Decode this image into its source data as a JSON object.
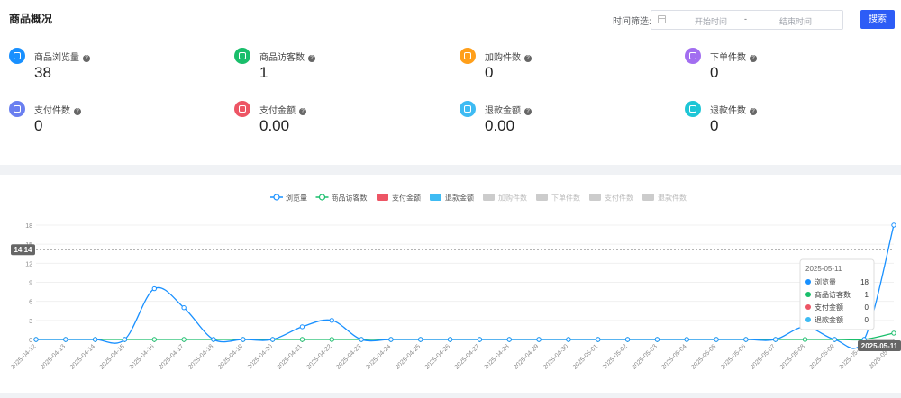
{
  "page": {
    "title": "商品概况"
  },
  "filter": {
    "label": "时间筛选:",
    "start_placeholder": "开始时间",
    "separator": "-",
    "end_placeholder": "结束时间",
    "search_label": "搜索"
  },
  "stats": [
    {
      "label": "商品浏览量",
      "value": "38",
      "color": "#1890ff"
    },
    {
      "label": "商品访客数",
      "value": "1",
      "color": "#19be6b"
    },
    {
      "label": "加购件数",
      "value": "0",
      "color": "#ff9f1a"
    },
    {
      "label": "下单件数",
      "value": "0",
      "color": "#a26ef0"
    },
    {
      "label": "支付件数",
      "value": "0",
      "color": "#6a7ff0"
    },
    {
      "label": "支付金额",
      "value": "0.00",
      "color": "#ed5565"
    },
    {
      "label": "退款金额",
      "value": "0.00",
      "color": "#3ebbf3"
    },
    {
      "label": "退款件数",
      "value": "0",
      "color": "#1ec6d6"
    }
  ],
  "chart_data": {
    "type": "line",
    "x": [
      "2025-04-12",
      "2025-04-13",
      "2025-04-14",
      "2025-04-15",
      "2025-04-16",
      "2025-04-17",
      "2025-04-18",
      "2025-04-19",
      "2025-04-20",
      "2025-04-21",
      "2025-04-22",
      "2025-04-23",
      "2025-04-24",
      "2025-04-25",
      "2025-04-26",
      "2025-04-27",
      "2025-04-28",
      "2025-04-29",
      "2025-04-30",
      "2025-05-01",
      "2025-05-02",
      "2025-05-03",
      "2025-05-04",
      "2025-05-05",
      "2025-05-06",
      "2025-05-07",
      "2025-05-08",
      "2025-05-09",
      "2025-05-10",
      "2025-05-11"
    ],
    "y_ticks": [
      "0",
      "3",
      "6",
      "9",
      "12",
      "15",
      "18"
    ],
    "ylim": [
      0,
      18
    ],
    "legend": [
      {
        "name": "浏览量",
        "color": "#1890ff",
        "shape": "line",
        "active": true
      },
      {
        "name": "商品访客数",
        "color": "#19be6b",
        "shape": "line",
        "active": true
      },
      {
        "name": "支付金额",
        "color": "#ed5565",
        "shape": "rect",
        "active": true
      },
      {
        "name": "退款金额",
        "color": "#3ebbf3",
        "shape": "rect",
        "active": true
      },
      {
        "name": "加购件数",
        "color": "#cccccc",
        "shape": "rect",
        "active": false
      },
      {
        "name": "下单件数",
        "color": "#cccccc",
        "shape": "rect",
        "active": false
      },
      {
        "name": "支付件数",
        "color": "#cccccc",
        "shape": "rect",
        "active": false
      },
      {
        "name": "退款件数",
        "color": "#cccccc",
        "shape": "rect",
        "active": false
      }
    ],
    "series": [
      {
        "name": "浏览量",
        "color": "#1890ff",
        "values": [
          0,
          0,
          0,
          0,
          8,
          5,
          0,
          0,
          0,
          2,
          3,
          0,
          0,
          0,
          0,
          0,
          0,
          0,
          0,
          0,
          0,
          0,
          0,
          0,
          0,
          0,
          2,
          0,
          0,
          18
        ]
      },
      {
        "name": "商品访客数",
        "color": "#19be6b",
        "values": [
          0,
          0,
          0,
          0,
          0,
          0,
          0,
          0,
          0,
          0,
          0,
          0,
          0,
          0,
          0,
          0,
          0,
          0,
          0,
          0,
          0,
          0,
          0,
          0,
          0,
          0,
          0,
          0,
          0,
          1
        ]
      }
    ],
    "crosshair": {
      "y_label": "14.14",
      "x_label": "2025-05-11"
    },
    "tooltip": {
      "title": "2025-05-11",
      "rows": [
        {
          "name": "浏览量",
          "value": "18",
          "color": "#1890ff"
        },
        {
          "name": "商品访客数",
          "value": "1",
          "color": "#19be6b"
        },
        {
          "name": "支付金额",
          "value": "0",
          "color": "#ed5565"
        },
        {
          "name": "退款金额",
          "value": "0",
          "color": "#3ebbf3"
        }
      ]
    }
  }
}
